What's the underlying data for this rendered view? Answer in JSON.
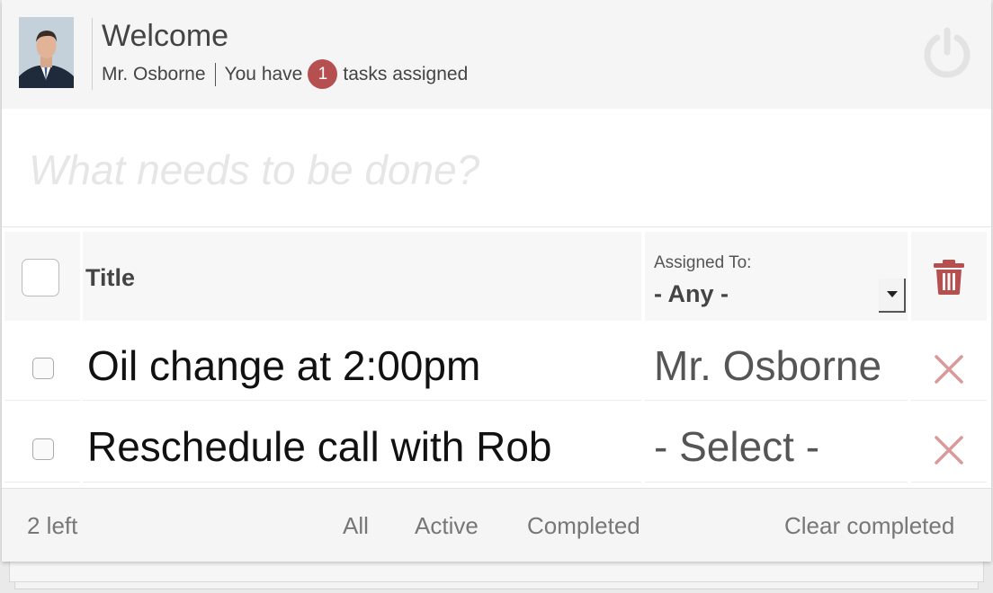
{
  "header": {
    "welcome": "Welcome",
    "user_name": "Mr. Osborne",
    "tasks_prefix": "You have",
    "task_count": "1",
    "tasks_suffix": "tasks assigned"
  },
  "new_todo": {
    "placeholder": "What needs to be done?"
  },
  "table": {
    "title_header": "Title",
    "assigned_label": "Assigned To:",
    "assigned_filter": "- Any -",
    "rows": [
      {
        "title": "Oil change at 2:00pm",
        "assignee": "Mr. Osborne"
      },
      {
        "title": "Reschedule call with Rob",
        "assignee": "- Select -"
      }
    ]
  },
  "footer": {
    "left_count": "2 left",
    "filters": [
      "All",
      "Active",
      "Completed"
    ],
    "clear": "Clear completed"
  },
  "colors": {
    "badge": "#b65050",
    "delete": "#b65050",
    "x": "#d99a9a"
  },
  "icons": {
    "power": "power-icon",
    "trash": "trash-icon",
    "delete": "close-icon"
  }
}
